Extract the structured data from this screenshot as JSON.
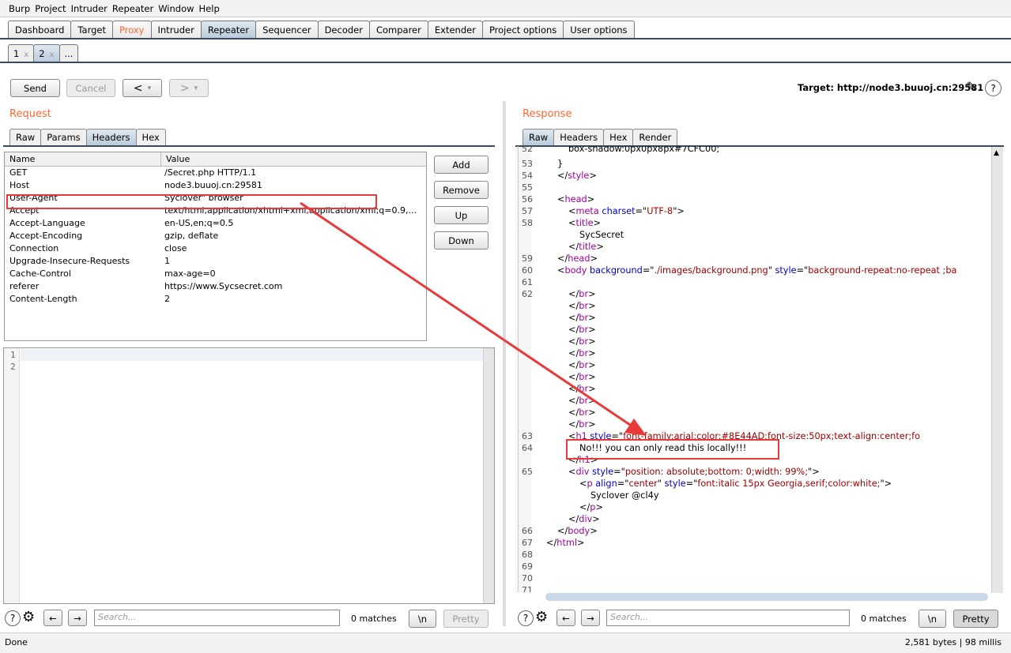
{
  "menu": [
    "Burp",
    "Project",
    "Intruder",
    "Repeater",
    "Window",
    "Help"
  ],
  "main_tabs": [
    {
      "label": "Dashboard"
    },
    {
      "label": "Target"
    },
    {
      "label": "Proxy",
      "highlight": true
    },
    {
      "label": "Intruder"
    },
    {
      "label": "Repeater",
      "selected": true
    },
    {
      "label": "Sequencer"
    },
    {
      "label": "Decoder"
    },
    {
      "label": "Comparer"
    },
    {
      "label": "Extender"
    },
    {
      "label": "Project options"
    },
    {
      "label": "User options"
    }
  ],
  "sub_tabs": [
    {
      "label": "1",
      "close": "x"
    },
    {
      "label": "2",
      "close": "x",
      "selected": true
    },
    {
      "label": "..."
    }
  ],
  "toolbar": {
    "send": "Send",
    "cancel": "Cancel",
    "back": "<",
    "fwd": ">",
    "dropdown": "▾",
    "target": "Target: http://node3.buuoj.cn:29581"
  },
  "request": {
    "title": "Request",
    "tabs": [
      "Raw",
      "Params",
      "Headers",
      "Hex"
    ],
    "selected_tab": "Headers",
    "columns": [
      "Name",
      "Value"
    ],
    "headers": [
      [
        "GET",
        "/Secret.php HTTP/1.1"
      ],
      [
        "Host",
        "node3.buuoj.cn:29581"
      ],
      [
        "User-Agent",
        "Syclover\" browser"
      ],
      [
        "Accept",
        "text/html,application/xhtml+xml,application/xml;q=0.9,..."
      ],
      [
        "Accept-Language",
        "en-US,en;q=0.5"
      ],
      [
        "Accept-Encoding",
        "gzip, deflate"
      ],
      [
        "Connection",
        "close"
      ],
      [
        "Upgrade-Insecure-Requests",
        "1"
      ],
      [
        "Cache-Control",
        "max-age=0"
      ],
      [
        "referer",
        "https://www.Sycsecret.com"
      ],
      [
        "Content-Length",
        "2"
      ]
    ],
    "buttons": [
      "Add",
      "Remove",
      "Up",
      "Down"
    ],
    "body_lines": [
      "1",
      "2"
    ],
    "search_placeholder": "Search...",
    "matches": "0 matches",
    "newline": "\\n",
    "pretty": "Pretty"
  },
  "response": {
    "title": "Response",
    "tabs": [
      "Raw",
      "Headers",
      "Hex",
      "Render"
    ],
    "selected_tab": "Raw",
    "lines": [
      {
        "n": "52",
        "i": 3,
        "s": [
          [
            "p",
            "box-shadow:0px0px8px#7CFC00;"
          ]
        ]
      },
      {
        "n": "53",
        "i": 2,
        "s": [
          [
            "p",
            "}"
          ]
        ]
      },
      {
        "n": "54",
        "i": 2,
        "s": [
          [
            "p",
            "</"
          ],
          [
            "t",
            "style"
          ],
          [
            "p",
            ">"
          ]
        ]
      },
      {
        "n": "55",
        "i": 0,
        "s": []
      },
      {
        "n": "56",
        "i": 2,
        "s": [
          [
            "p",
            "<"
          ],
          [
            "t",
            "head"
          ],
          [
            "p",
            ">"
          ]
        ]
      },
      {
        "n": "57",
        "i": 3,
        "s": [
          [
            "p",
            "<"
          ],
          [
            "t",
            "meta "
          ],
          [
            "a",
            "charset"
          ],
          [
            "p",
            "=\""
          ],
          [
            "v",
            "UTF-8"
          ],
          [
            "p",
            "\">"
          ]
        ]
      },
      {
        "n": "58",
        "i": 3,
        "s": [
          [
            "p",
            "<"
          ],
          [
            "t",
            "title"
          ],
          [
            "p",
            ">"
          ]
        ]
      },
      {
        "n": "",
        "i": 4,
        "s": [
          [
            "p",
            "SycSecret"
          ]
        ]
      },
      {
        "n": "",
        "i": 3,
        "s": [
          [
            "p",
            "</"
          ],
          [
            "t",
            "title"
          ],
          [
            "p",
            ">"
          ]
        ]
      },
      {
        "n": "59",
        "i": 2,
        "s": [
          [
            "p",
            "</"
          ],
          [
            "t",
            "head"
          ],
          [
            "p",
            ">"
          ]
        ]
      },
      {
        "n": "60",
        "i": 2,
        "s": [
          [
            "p",
            "<"
          ],
          [
            "t",
            "body "
          ],
          [
            "a",
            "background"
          ],
          [
            "p",
            "=\""
          ],
          [
            "v",
            "./images/background.png"
          ],
          [
            "p",
            "\" "
          ],
          [
            "a",
            "style"
          ],
          [
            "p",
            "=\""
          ],
          [
            "v",
            "background-repeat:no-repeat ;ba"
          ]
        ]
      },
      {
        "n": "61",
        "i": 0,
        "s": []
      },
      {
        "n": "62",
        "i": 3,
        "s": [
          [
            "p",
            "</"
          ],
          [
            "t",
            "br"
          ],
          [
            "p",
            ">"
          ]
        ]
      },
      {
        "n": "",
        "i": 3,
        "s": [
          [
            "p",
            "</"
          ],
          [
            "t",
            "br"
          ],
          [
            "p",
            ">"
          ]
        ]
      },
      {
        "n": "",
        "i": 3,
        "s": [
          [
            "p",
            "</"
          ],
          [
            "t",
            "br"
          ],
          [
            "p",
            ">"
          ]
        ]
      },
      {
        "n": "",
        "i": 3,
        "s": [
          [
            "p",
            "</"
          ],
          [
            "t",
            "br"
          ],
          [
            "p",
            ">"
          ]
        ]
      },
      {
        "n": "",
        "i": 3,
        "s": [
          [
            "p",
            "</"
          ],
          [
            "t",
            "br"
          ],
          [
            "p",
            ">"
          ]
        ]
      },
      {
        "n": "",
        "i": 3,
        "s": [
          [
            "p",
            "</"
          ],
          [
            "t",
            "br"
          ],
          [
            "p",
            ">"
          ]
        ]
      },
      {
        "n": "",
        "i": 3,
        "s": [
          [
            "p",
            "</"
          ],
          [
            "t",
            "br"
          ],
          [
            "p",
            ">"
          ]
        ]
      },
      {
        "n": "",
        "i": 3,
        "s": [
          [
            "p",
            "</"
          ],
          [
            "t",
            "br"
          ],
          [
            "p",
            ">"
          ]
        ]
      },
      {
        "n": "",
        "i": 3,
        "s": [
          [
            "p",
            "</"
          ],
          [
            "t",
            "br"
          ],
          [
            "p",
            ">"
          ]
        ]
      },
      {
        "n": "",
        "i": 3,
        "s": [
          [
            "p",
            "</"
          ],
          [
            "t",
            "br"
          ],
          [
            "p",
            ">"
          ]
        ]
      },
      {
        "n": "",
        "i": 3,
        "s": [
          [
            "p",
            "</"
          ],
          [
            "t",
            "br"
          ],
          [
            "p",
            ">"
          ]
        ]
      },
      {
        "n": "",
        "i": 3,
        "s": [
          [
            "p",
            "</"
          ],
          [
            "t",
            "br"
          ],
          [
            "p",
            ">"
          ]
        ]
      },
      {
        "n": "63",
        "i": 3,
        "s": [
          [
            "p",
            "<"
          ],
          [
            "t",
            "h1 "
          ],
          [
            "a",
            "style"
          ],
          [
            "p",
            "=\""
          ],
          [
            "v",
            "font-family:arial;color:#8E44AD;font-size:50px;text-align:center;fo"
          ]
        ]
      },
      {
        "n": "64",
        "i": 4,
        "s": [
          [
            "p",
            "No!!! you can only read this locally!!!"
          ]
        ]
      },
      {
        "n": "",
        "i": 3,
        "s": [
          [
            "p",
            "</"
          ],
          [
            "t",
            "h1"
          ],
          [
            "p",
            ">"
          ]
        ]
      },
      {
        "n": "65",
        "i": 3,
        "s": [
          [
            "p",
            "<"
          ],
          [
            "t",
            "div "
          ],
          [
            "a",
            "style"
          ],
          [
            "p",
            "=\""
          ],
          [
            "v",
            "position: absolute;bottom: 0;width: 99%;"
          ],
          [
            "p",
            "\">"
          ]
        ]
      },
      {
        "n": "",
        "i": 4,
        "s": [
          [
            "p",
            "<"
          ],
          [
            "t",
            "p "
          ],
          [
            "a",
            "align"
          ],
          [
            "p",
            "=\""
          ],
          [
            "v",
            "center"
          ],
          [
            "p",
            "\" "
          ],
          [
            "a",
            "style"
          ],
          [
            "p",
            "=\""
          ],
          [
            "v",
            "font:italic 15px Georgia,serif;color:white;"
          ],
          [
            "p",
            "\">"
          ]
        ]
      },
      {
        "n": "",
        "i": 5,
        "s": [
          [
            "p",
            "Syclover @cl4y"
          ]
        ]
      },
      {
        "n": "",
        "i": 4,
        "s": [
          [
            "p",
            "</"
          ],
          [
            "t",
            "p"
          ],
          [
            "p",
            ">"
          ]
        ]
      },
      {
        "n": "",
        "i": 3,
        "s": [
          [
            "p",
            "</"
          ],
          [
            "t",
            "div"
          ],
          [
            "p",
            ">"
          ]
        ]
      },
      {
        "n": "66",
        "i": 2,
        "s": [
          [
            "p",
            "</"
          ],
          [
            "t",
            "body"
          ],
          [
            "p",
            ">"
          ]
        ]
      },
      {
        "n": "67",
        "i": 1,
        "s": [
          [
            "p",
            "</"
          ],
          [
            "t",
            "html"
          ],
          [
            "p",
            ">"
          ]
        ]
      },
      {
        "n": "68",
        "i": 0,
        "s": []
      },
      {
        "n": "69",
        "i": 0,
        "s": []
      },
      {
        "n": "70",
        "i": 0,
        "s": []
      },
      {
        "n": "71",
        "i": 0,
        "s": []
      }
    ],
    "search_placeholder": "Search...",
    "matches": "0 matches",
    "newline": "\\n",
    "pretty": "Pretty"
  },
  "status": {
    "left": "Done",
    "right": "2,581 bytes | 98 millis"
  },
  "colors": {
    "accent": "#ff6633",
    "annotation": "#e83a3a",
    "tag": "#a000a0",
    "attr": "#0000c0",
    "value": "#a00000"
  }
}
